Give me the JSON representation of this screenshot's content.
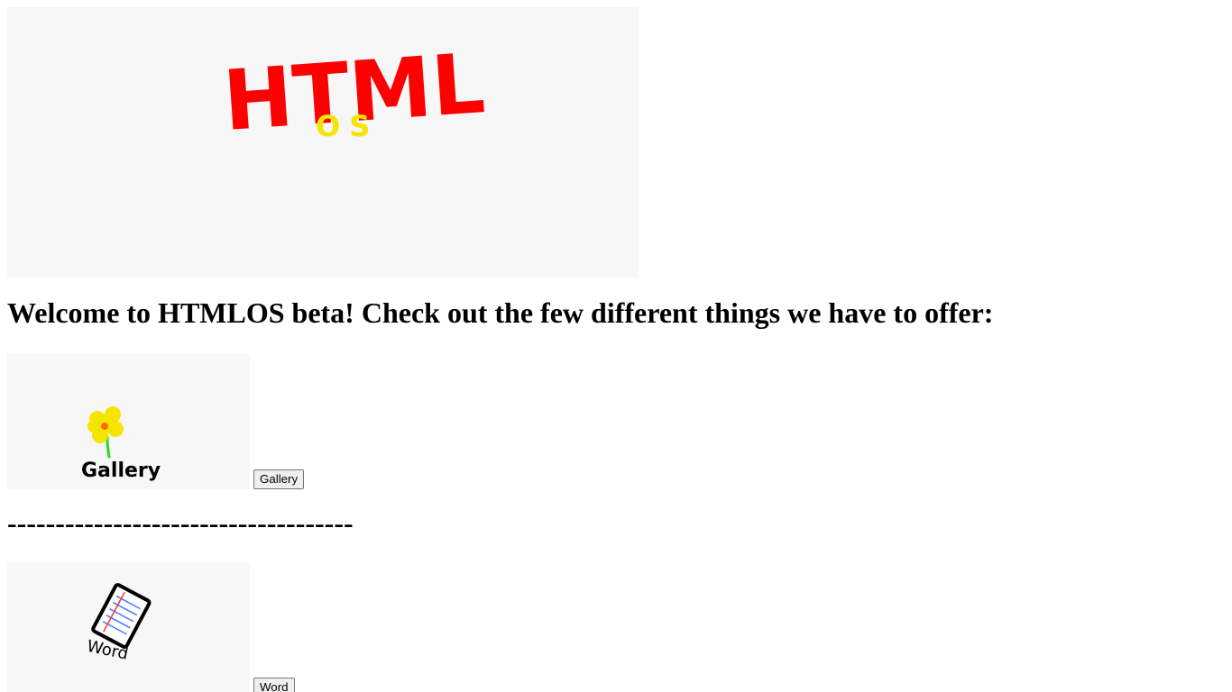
{
  "header": {
    "logo_title": "HTML",
    "logo_subtitle": "OS",
    "logo_colors": {
      "title": "#ff0000",
      "subtitle": "#f5e400"
    }
  },
  "welcome_heading": "Welcome to HTMLOS beta! Check out the few different things we have to offer:",
  "apps": [
    {
      "thumb_label": "Gallery",
      "button_label": "Gallery",
      "icon": "flower-icon"
    },
    {
      "thumb_label": "Word",
      "button_label": "Word",
      "icon": "document-icon"
    }
  ],
  "divider_text": "------------------------------------"
}
